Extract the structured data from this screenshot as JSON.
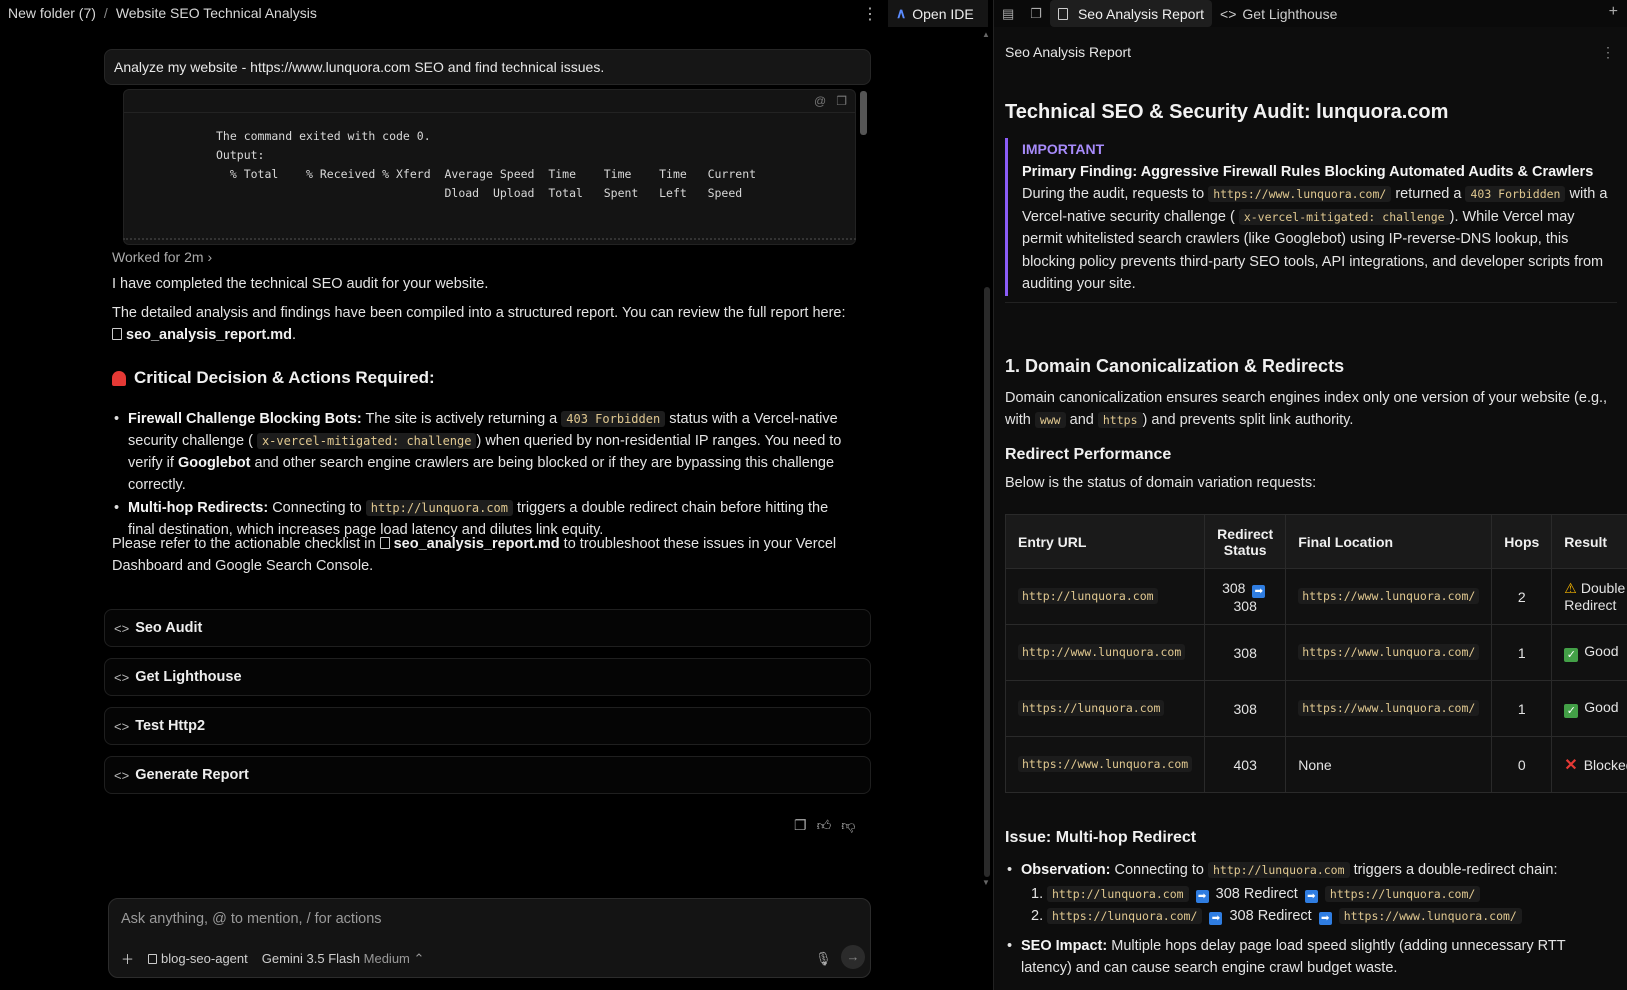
{
  "breadcrumb": {
    "folder": "New folder (7)",
    "separator": "/",
    "title": "Website SEO Technical Analysis"
  },
  "open_ide_label": "Open IDE",
  "chat": {
    "user_prompt": "Analyze my website - https://www.lunquora.com SEO and find technical issues.",
    "terminal_output": "The command exited with code 0.\nOutput:\n  % Total    % Received % Xferd  Average Speed  Time    Time    Time   Current\n                                 Dload  Upload  Total   Spent   Left   Speed",
    "worked_for": "Worked for 2m",
    "intro": "I have completed the technical SEO audit for your website.",
    "report_text": "The detailed analysis and findings have been compiled into a structured report. You can review the full report here:",
    "report_file": "seo_analysis_report.md",
    "report_dot": ".",
    "section_title": "Critical Decision & Actions Required:",
    "bullets": [
      {
        "title": "Firewall Challenge Blocking Bots:",
        "t1": "The site is actively returning a",
        "c1": "403 Forbidden",
        "t2": "status with a Vercel-native security challenge (",
        "c2": "x-vercel-mitigated: challenge",
        "t3": ") when queried by non-residential IP ranges. You need to verify if",
        "b2": "Googlebot",
        "t4": "and other search engine crawlers are being blocked or if they are bypassing this challenge correctly."
      },
      {
        "title": "Multi-hop Redirects:",
        "t1": "Connecting to",
        "c1": "http://lunquora.com",
        "t2": "triggers a double redirect chain before hitting the final destination, which increases page load latency and dilutes link equity."
      }
    ],
    "closing_1": "Please refer to the actionable checklist in",
    "closing_file": "seo_analysis_report.md",
    "closing_2": "to troubleshoot these issues in your Vercel Dashboard and Google Search Console.",
    "tools": [
      "Seo Audit",
      "Get Lighthouse",
      "Test Http2",
      "Generate Report"
    ],
    "input_placeholder": "Ask anything, @ to mention, / for actions",
    "agent_name": "blog-seo-agent",
    "model_name": "Gemini 3.5 Flash",
    "model_mode": "Medium"
  },
  "right": {
    "tabs": [
      "Seo Analysis Report",
      "Get Lighthouse"
    ],
    "doc_title": "Seo Analysis Report",
    "h1": "Technical SEO & Security Audit: lunquora.com",
    "callout": {
      "label": "IMPORTANT",
      "bold": "Primary Finding: Aggressive Firewall Rules Blocking Automated Audits & Crawlers",
      "t1": "During the audit, requests to",
      "c1": "https://www.lunquora.com/",
      "t2": "returned a",
      "c2": "403 Forbidden",
      "t3": "with a Vercel-native security challenge (",
      "c3": "x-vercel-mitigated: challenge",
      "t4": "). While Vercel may permit whitelisted search crawlers (like Googlebot) using IP-reverse-DNS lookup, this blocking policy prevents third-party SEO tools, API integrations, and developer scripts from auditing your site."
    },
    "h2": "1. Domain Canonicalization & Redirects",
    "canon_t1": "Domain canonicalization ensures search engines index only one version of your website (e.g., with",
    "canon_c1": "www",
    "canon_and": "and",
    "canon_c2": "https",
    "canon_t2": ") and prevents split link authority.",
    "redirect_h": "Redirect Performance",
    "redirect_p": "Below is the status of domain variation requests:",
    "table": {
      "headers": [
        "Entry URL",
        "Redirect Status",
        "Final Location",
        "Hops",
        "Result"
      ],
      "rows": [
        {
          "entry": "http://lunquora.com",
          "status_a": "308",
          "status_b": "308",
          "final": "https://www.lunquora.com/",
          "hops": "2",
          "result": "Double Redirect",
          "kind": "warn"
        },
        {
          "entry": "http://www.lunquora.com",
          "status": "308",
          "final": "https://www.lunquora.com/",
          "hops": "1",
          "result": "Good",
          "kind": "good"
        },
        {
          "entry": "https://lunquora.com",
          "status": "308",
          "final": "https://www.lunquora.com/",
          "hops": "1",
          "result": "Good",
          "kind": "good"
        },
        {
          "entry": "https://www.lunquora.com",
          "status": "403",
          "final": "None",
          "hops": "0",
          "result": "Blocked",
          "kind": "bad"
        }
      ]
    },
    "issue_h": "Issue: Multi-hop Redirect",
    "obs_title": "Observation:",
    "obs_t1": "Connecting to",
    "obs_c1": "http://lunquora.com",
    "obs_t2": "triggers a double-redirect chain:",
    "steps": [
      {
        "n": "1.",
        "from": "http://lunquora.com",
        "label": "308 Redirect",
        "to": "https://lunquora.com/"
      },
      {
        "n": "2.",
        "from": "https://lunquora.com/",
        "label": "308 Redirect",
        "to": "https://www.lunquora.com/"
      }
    ],
    "impact_title": "SEO Impact:",
    "impact_text": "Multiple hops delay page load speed slightly (adding unnecessary RTT latency) and can cause search engine crawl budget waste."
  }
}
